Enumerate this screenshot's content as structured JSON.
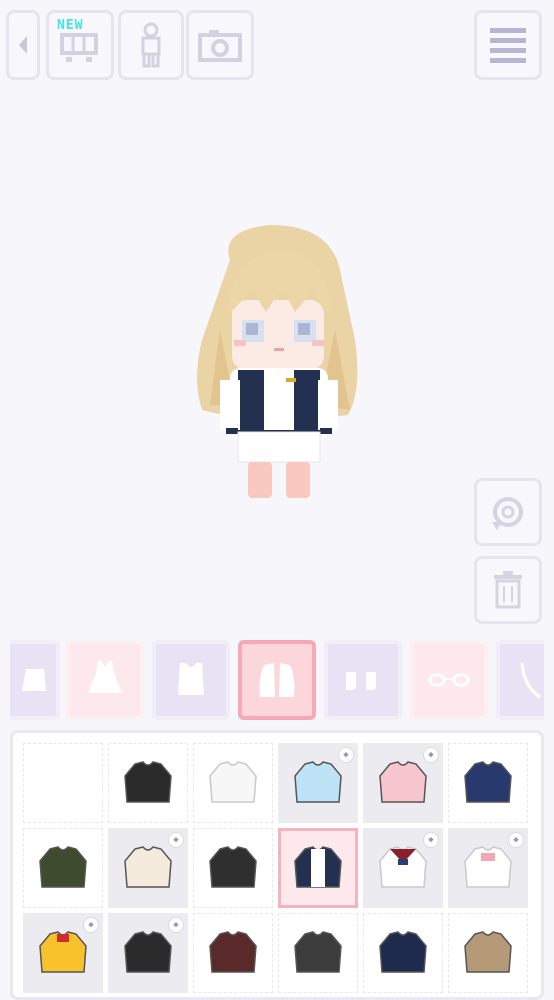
{
  "toolbar": {
    "new_badge": "NEW",
    "buttons": [
      "back",
      "shop",
      "body",
      "camera",
      "menu"
    ]
  },
  "side_buttons": [
    "rotate",
    "delete"
  ],
  "categories": [
    "skirt",
    "dress",
    "top",
    "outerwear",
    "socks",
    "glasses",
    "accessory"
  ],
  "active_category": "outerwear",
  "closet": {
    "rows": 3,
    "columns": 6,
    "items": [
      {
        "name": "empty"
      },
      {
        "name": "black-hoodie",
        "color": "#2a2a2a"
      },
      {
        "name": "white-hoodie",
        "color": "#f7f7f7"
      },
      {
        "name": "lightblue-hoodie",
        "color": "#bfe3f6",
        "locked": true
      },
      {
        "name": "pink-hoodie",
        "color": "#f7c6cf",
        "locked": true
      },
      {
        "name": "navy-sweater",
        "color": "#283a6d"
      },
      {
        "name": "olive-cardigan",
        "color": "#3e4b2f"
      },
      {
        "name": "cream-cardigan",
        "color": "#f4ebdc",
        "locked": true
      },
      {
        "name": "black-jacket",
        "color": "#2f2f2f"
      },
      {
        "name": "varsity-jacket",
        "color": "#23304f",
        "selected": true
      },
      {
        "name": "sailor-blouse",
        "color": "#ffffff",
        "locked": true
      },
      {
        "name": "pink-bow-blouse",
        "color": "#ffffff",
        "locked": true
      },
      {
        "name": "yellow-raincoat",
        "color": "#f8c22d",
        "locked": true
      },
      {
        "name": "black-long-coat",
        "color": "#2b2b2b",
        "locked": true
      },
      {
        "name": "maroon-coat",
        "color": "#5a2a2a"
      },
      {
        "name": "gray-coat",
        "color": "#3c3c3c"
      },
      {
        "name": "navy-coat",
        "color": "#1f2b4d"
      },
      {
        "name": "tan-coat",
        "color": "#b59a78"
      }
    ]
  },
  "colors": {
    "accent": "#f7a9b3",
    "new_badge": "#41e3e6"
  }
}
